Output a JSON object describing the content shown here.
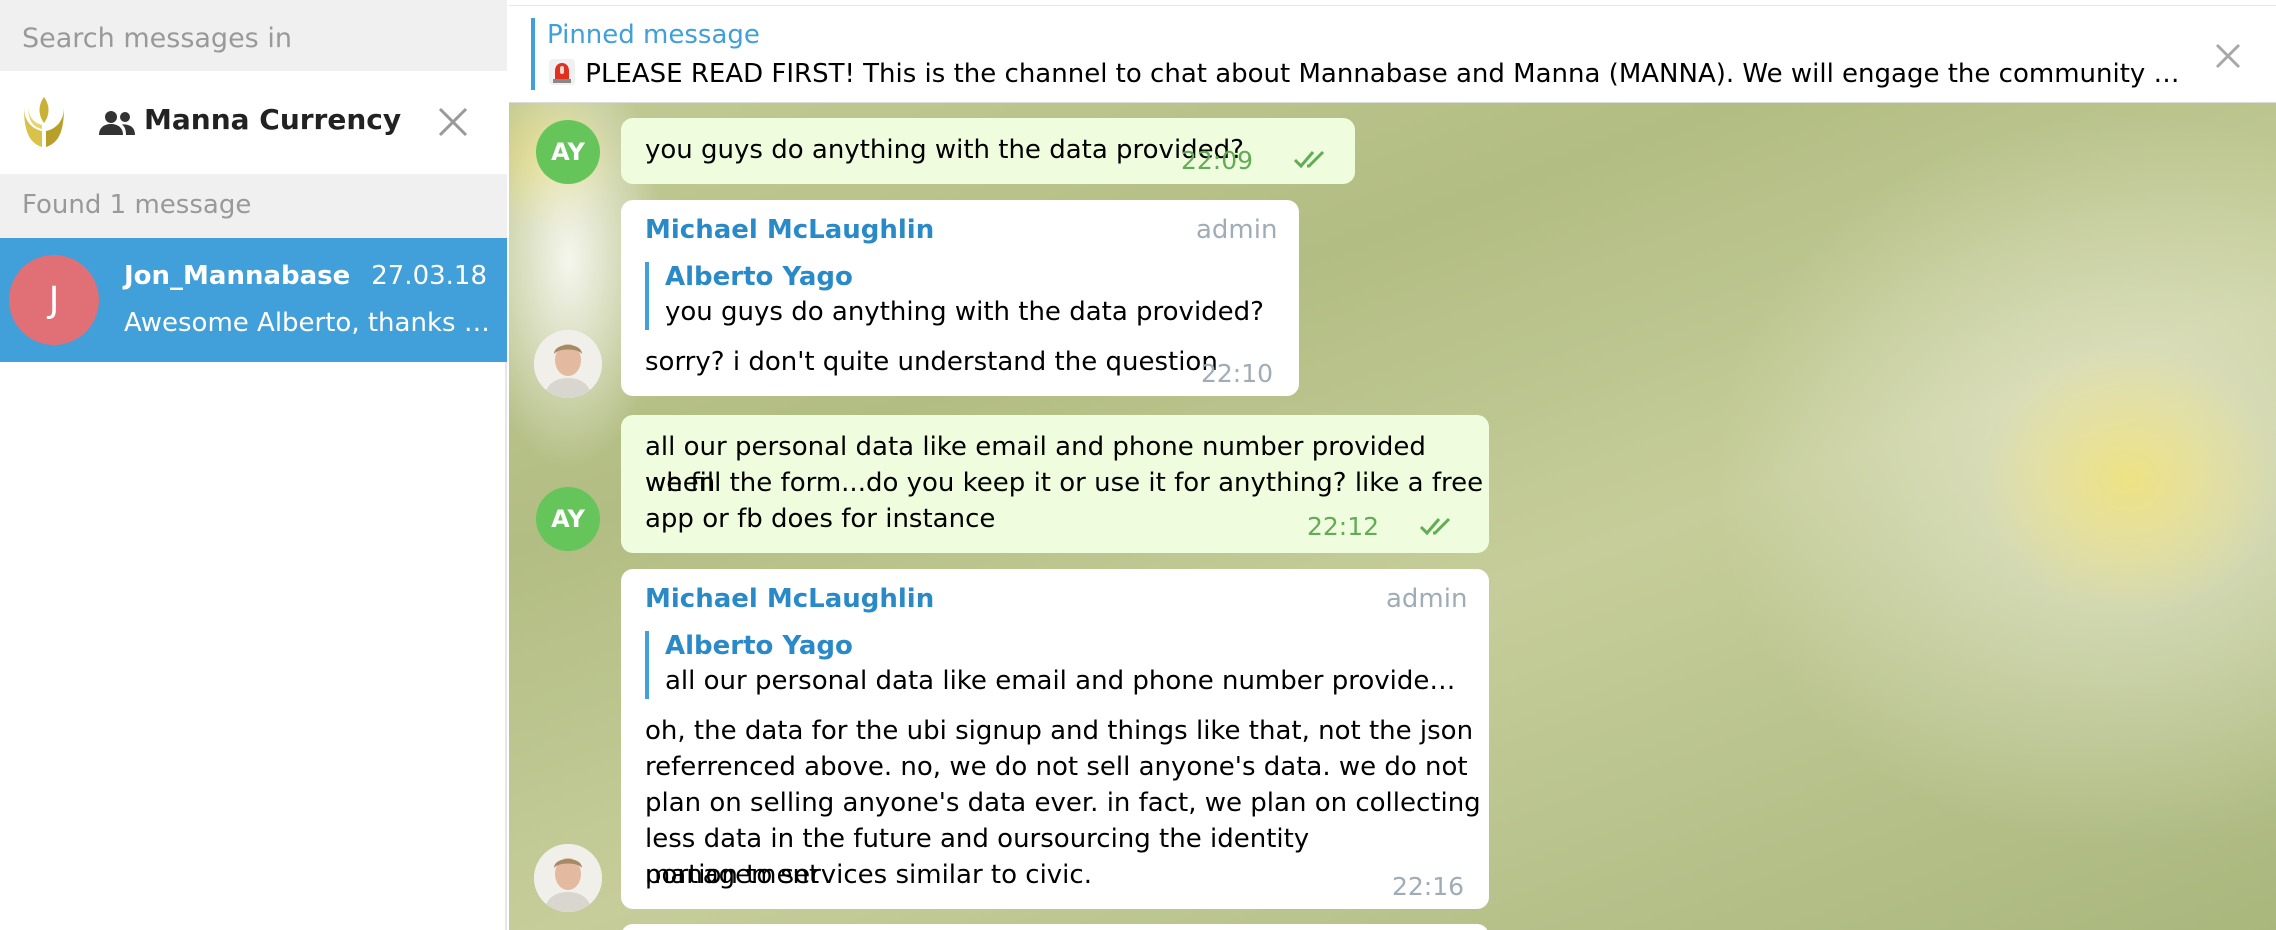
{
  "sidebar": {
    "search_placeholder": "Search messages in",
    "chat_filter": {
      "title": "Manna Currency"
    },
    "found_text": "Found 1 message",
    "results": [
      {
        "avatar_letter": "J",
        "avatar_color": "#e17076",
        "name": "Jon_Mannabase",
        "date": "27.03.18",
        "preview": "Awesome Alberto, thanks so..."
      }
    ]
  },
  "pinned": {
    "title": "Pinned message",
    "text": "PLEASE READ FIRST!  This is the channel to chat about Mannabase and Manna (MANNA). We will engage the community to a..."
  },
  "messages": [
    {
      "sender_initials": "AY",
      "lines": [
        "you guys do anything with the data provided?"
      ],
      "time": "22:09"
    },
    {
      "sender": "Michael McLaughlin",
      "role": "admin",
      "reply_to": {
        "name": "Alberto Yago",
        "text": "you guys do anything with the data provided?"
      },
      "lines": [
        "sorry? i don't quite understand the question"
      ],
      "time": "22:10"
    },
    {
      "sender_initials": "AY",
      "lines": [
        "all our personal data like email and phone number provided when",
        "we fill the form...do you keep it or use it for anything? like a free",
        "app or fb does for instance"
      ],
      "time": "22:12"
    },
    {
      "sender": "Michael McLaughlin",
      "role": "admin",
      "reply_to": {
        "name": "Alberto Yago",
        "text": "all our personal data like email and phone number provided w..."
      },
      "lines": [
        "oh, the data for the ubi signup and things like that, not the json",
        "referrenced above. no, we do not sell anyone's data. we do not",
        "plan on selling anyone's data ever. in fact, we plan on collecting",
        "less data in the future and oursourcing the identity management",
        "portion to services similar to civic."
      ],
      "time": "22:16"
    }
  ],
  "colors": {
    "accent": "#419fd9",
    "outgoing_bubble": "#effdde",
    "incoming_bubble": "#ffffff",
    "ay_avatar": "#65c55a",
    "sender_name": "#2a8ac7"
  }
}
